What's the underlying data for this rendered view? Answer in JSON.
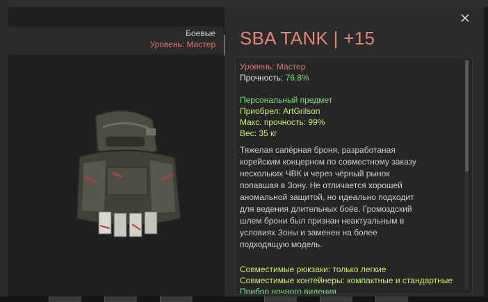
{
  "colors": {
    "title": "#e2867a",
    "level": "#e07a6d",
    "green": "#7de07d",
    "lime": "#c8f06a"
  },
  "item": {
    "category": "Боевые",
    "level_left": "Уровень: Мастер",
    "title": "SBA TANK | +15",
    "level_label": "Уровень: Мастер",
    "durability_label": "Прочность:",
    "durability_value": "76.8%",
    "personal": "Персональный предмет",
    "acquired_by": "Приобрел: ArtGrilson",
    "max_durability": "Макс. прочность: 99%",
    "weight": "Вес: 35 кг",
    "description_lines": [
      "Тяжелая сапёрная броня, разработаная",
      "корейским концерном по совместному заказу",
      "нескольких ЧВК и через чёрный рынок",
      "попавшая в Зону. Не отличается хорошей",
      "аномальной защитой, но идеально подходит",
      "для ведения длительных боёв. Громоздский",
      "шлем брони был признан неактуальным в",
      "условиях Зоны и заменен на более",
      "подходящую модель."
    ],
    "compat_backpacks": "Совместимые рюкзаки: только легкие",
    "compat_containers": "Совместимые контейнеры: компактные и стандартные",
    "night_vision": "Прибор ночного видения"
  },
  "icons": {
    "close": "close-icon",
    "item": "armor-item-icon"
  }
}
